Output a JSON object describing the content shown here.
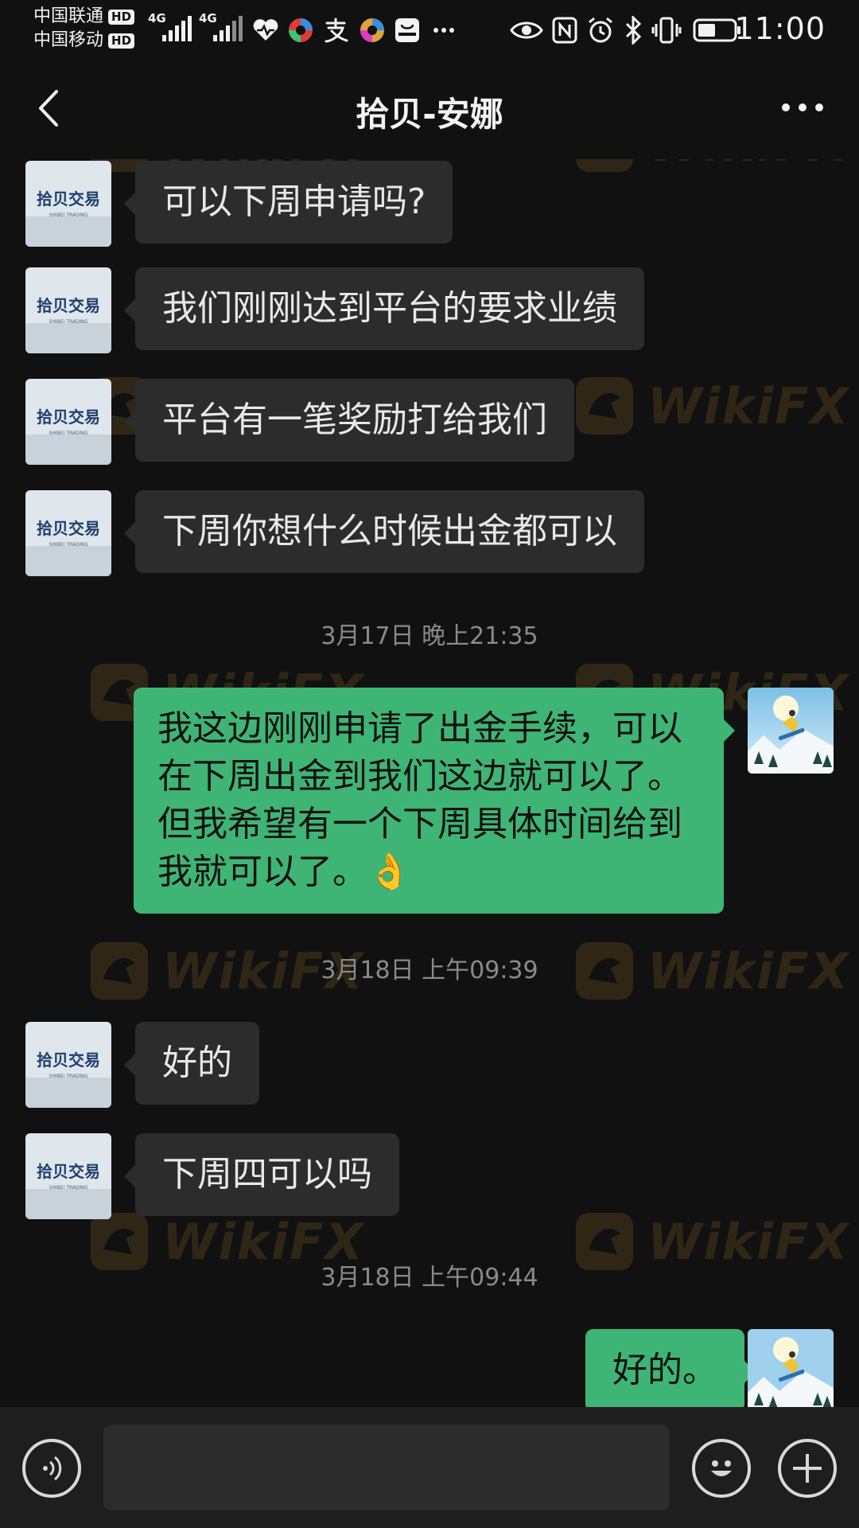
{
  "status_bar": {
    "carrier_1": "中国联通",
    "carrier_2": "中国移动",
    "hd_label": "HD",
    "network_1": "4G",
    "network_2": "4G",
    "clock": "11:00",
    "battery_percent": 50,
    "notification_icons": [
      "health-heart-icon",
      "app-icon",
      "alipay-icon",
      "app-icon",
      "huawei-icon",
      "more-dots-icon"
    ],
    "system_icons": [
      "eye-icon",
      "nfc-icon",
      "alarm-icon",
      "bluetooth-icon",
      "vibrate-icon",
      "battery-icon"
    ]
  },
  "header": {
    "title": "拾贝-安娜"
  },
  "watermark": {
    "text": "WikiFX",
    "color": "#f5b43c"
  },
  "contact_avatar": {
    "logo_text": "拾贝交易",
    "logo_subtext": "SHIBEI TRADING"
  },
  "messages": [
    {
      "from": "contact",
      "text": "可以下周申请吗?"
    },
    {
      "from": "contact",
      "text": "我们刚刚达到平台的要求业绩"
    },
    {
      "from": "contact",
      "text": "平台有一笔奖励打给我们"
    },
    {
      "from": "contact",
      "text": "下周你想什么时候出金都可以"
    },
    {
      "type": "time",
      "text": "3月17日 晚上21:35"
    },
    {
      "from": "me",
      "text": "我这边刚刚申请了出金手续，可以在下周出金到我们这边就可以了。但我希望有一个下周具体时间给到我就可以了。👌"
    },
    {
      "type": "time",
      "text": "3月18日 上午09:39"
    },
    {
      "from": "contact",
      "text": "好的"
    },
    {
      "from": "contact",
      "text": "下周四可以吗"
    },
    {
      "type": "time",
      "text": "3月18日 上午09:44"
    },
    {
      "from": "me",
      "text": "好的。"
    }
  ],
  "input_bar": {
    "placeholder": "",
    "value": ""
  },
  "colors": {
    "background": "#111111",
    "incoming_bubble": "#2c2c2c",
    "outgoing_bubble": "#3eb575",
    "timestamp": "#8a8a8a"
  }
}
